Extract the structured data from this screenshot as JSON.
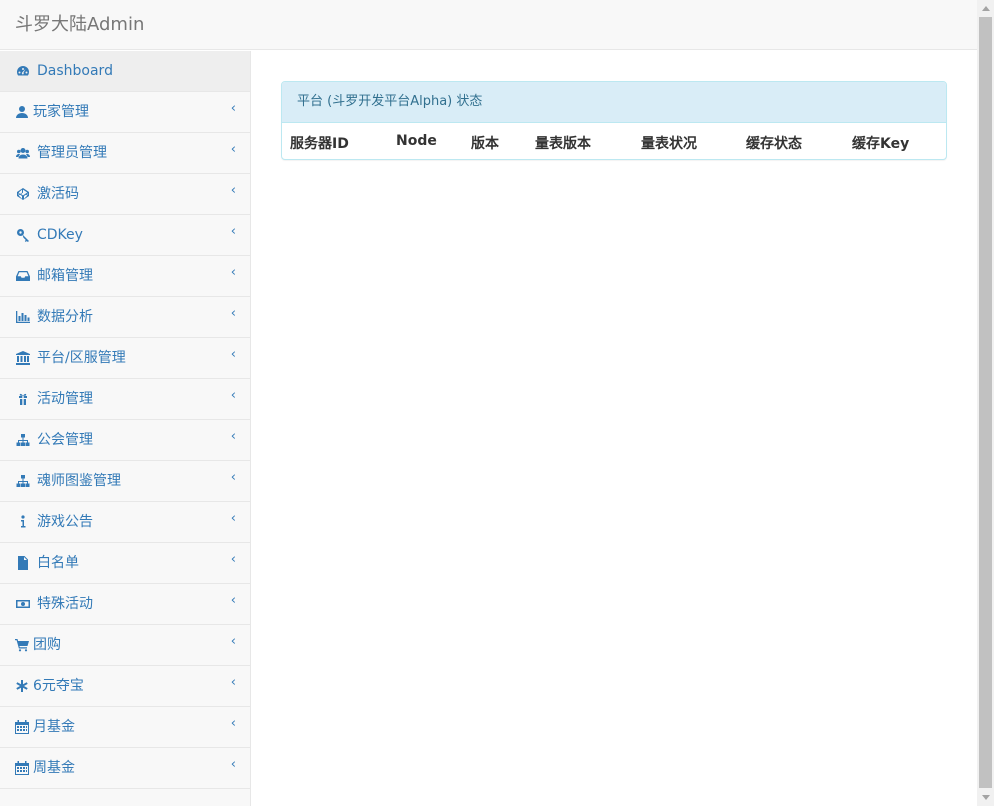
{
  "header": {
    "brand": "斗罗大陆Admin"
  },
  "sidebar": {
    "items": [
      {
        "label": "Dashboard",
        "icon": "dashboard-icon",
        "active": true,
        "chevron": false
      },
      {
        "label": "玩家管理",
        "icon": "user-icon",
        "chevron": true
      },
      {
        "label": "管理员管理",
        "icon": "users-icon",
        "chevron": true
      },
      {
        "label": "激活码",
        "icon": "codepen-icon",
        "chevron": true
      },
      {
        "label": "CDKey",
        "icon": "key-icon",
        "chevron": true
      },
      {
        "label": "邮箱管理",
        "icon": "inbox-icon",
        "chevron": true
      },
      {
        "label": "数据分析",
        "icon": "bar-chart-icon",
        "chevron": true
      },
      {
        "label": "平台/区服管理",
        "icon": "bank-icon",
        "chevron": true
      },
      {
        "label": "活动管理",
        "icon": "gift-icon",
        "chevron": true
      },
      {
        "label": "公会管理",
        "icon": "sitemap-icon",
        "chevron": true
      },
      {
        "label": "魂师图鉴管理",
        "icon": "sitemap-icon",
        "chevron": true
      },
      {
        "label": "游戏公告",
        "icon": "info-icon",
        "chevron": true
      },
      {
        "label": "白名单",
        "icon": "file-icon",
        "chevron": true
      },
      {
        "label": "特殊活动",
        "icon": "money-icon",
        "chevron": true
      },
      {
        "label": "团购",
        "icon": "cart-icon",
        "chevron": true
      },
      {
        "label": "6元夺宝",
        "icon": "asterisk-icon",
        "chevron": true
      },
      {
        "label": "月基金",
        "icon": "calendar-icon",
        "chevron": true
      },
      {
        "label": "周基金",
        "icon": "calendar-icon",
        "chevron": true
      }
    ],
    "chevron_glyph": "‹"
  },
  "panel": {
    "title": "平台 (斗罗开发平台Alpha) 状态",
    "columns": [
      "服务器ID",
      "Node",
      "版本",
      "量表版本",
      "量表状况",
      "缓存状态",
      "缓存Key"
    ]
  },
  "colors": {
    "link": "#337ab7",
    "panel_heading_bg": "#d9edf7",
    "panel_border": "#bce8f1",
    "panel_heading_text": "#31708f"
  }
}
